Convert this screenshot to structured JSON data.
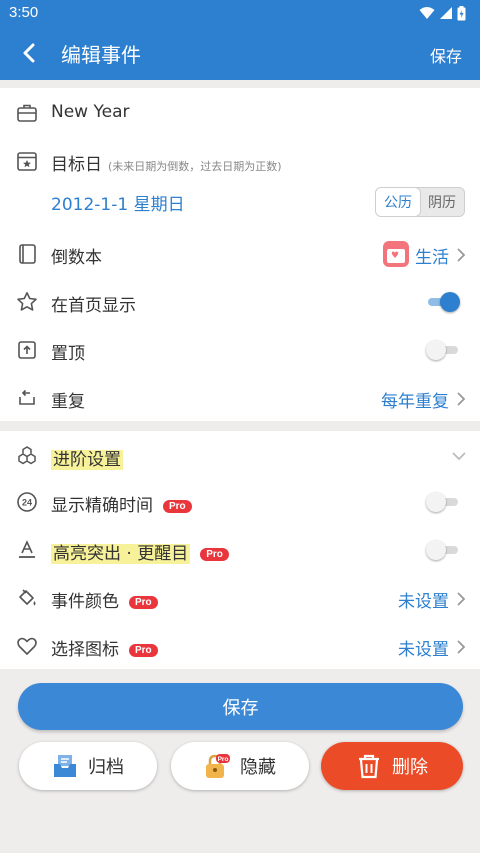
{
  "status_bar": {
    "time": "3:50"
  },
  "app_bar": {
    "title": "编辑事件",
    "save_label": "保存"
  },
  "event": {
    "name": "New Year",
    "target_label": "目标日",
    "target_hint": "(未来日期为倒数，过去日期为正数)",
    "date": "2012-1-1 星期日",
    "calendar_options": [
      "公历",
      "阴历"
    ],
    "calendar_selected": "公历",
    "book_label": "倒数本",
    "book_value": "生活",
    "show_home_label": "在首页显示",
    "show_home_on": true,
    "pin_label": "置顶",
    "pin_on": false,
    "repeat_label": "重复",
    "repeat_value": "每年重复"
  },
  "advanced": {
    "title": "进阶设置",
    "exact_time_label": "显示精确时间",
    "exact_time_on": false,
    "highlight_label": "高亮突出 · 更醒目",
    "highlight_on": false,
    "color_label": "事件颜色",
    "color_value": "未设置",
    "icon_label": "选择图标",
    "icon_value": "未设置",
    "pro_badge": "Pro"
  },
  "actions": {
    "save": "保存",
    "archive": "归档",
    "hide": "隐藏",
    "delete": "删除"
  },
  "colors": {
    "primary": "#2d7fcf",
    "delete": "#ec4b28",
    "pro": "#e8363c",
    "highlight": "#f7f29a"
  }
}
